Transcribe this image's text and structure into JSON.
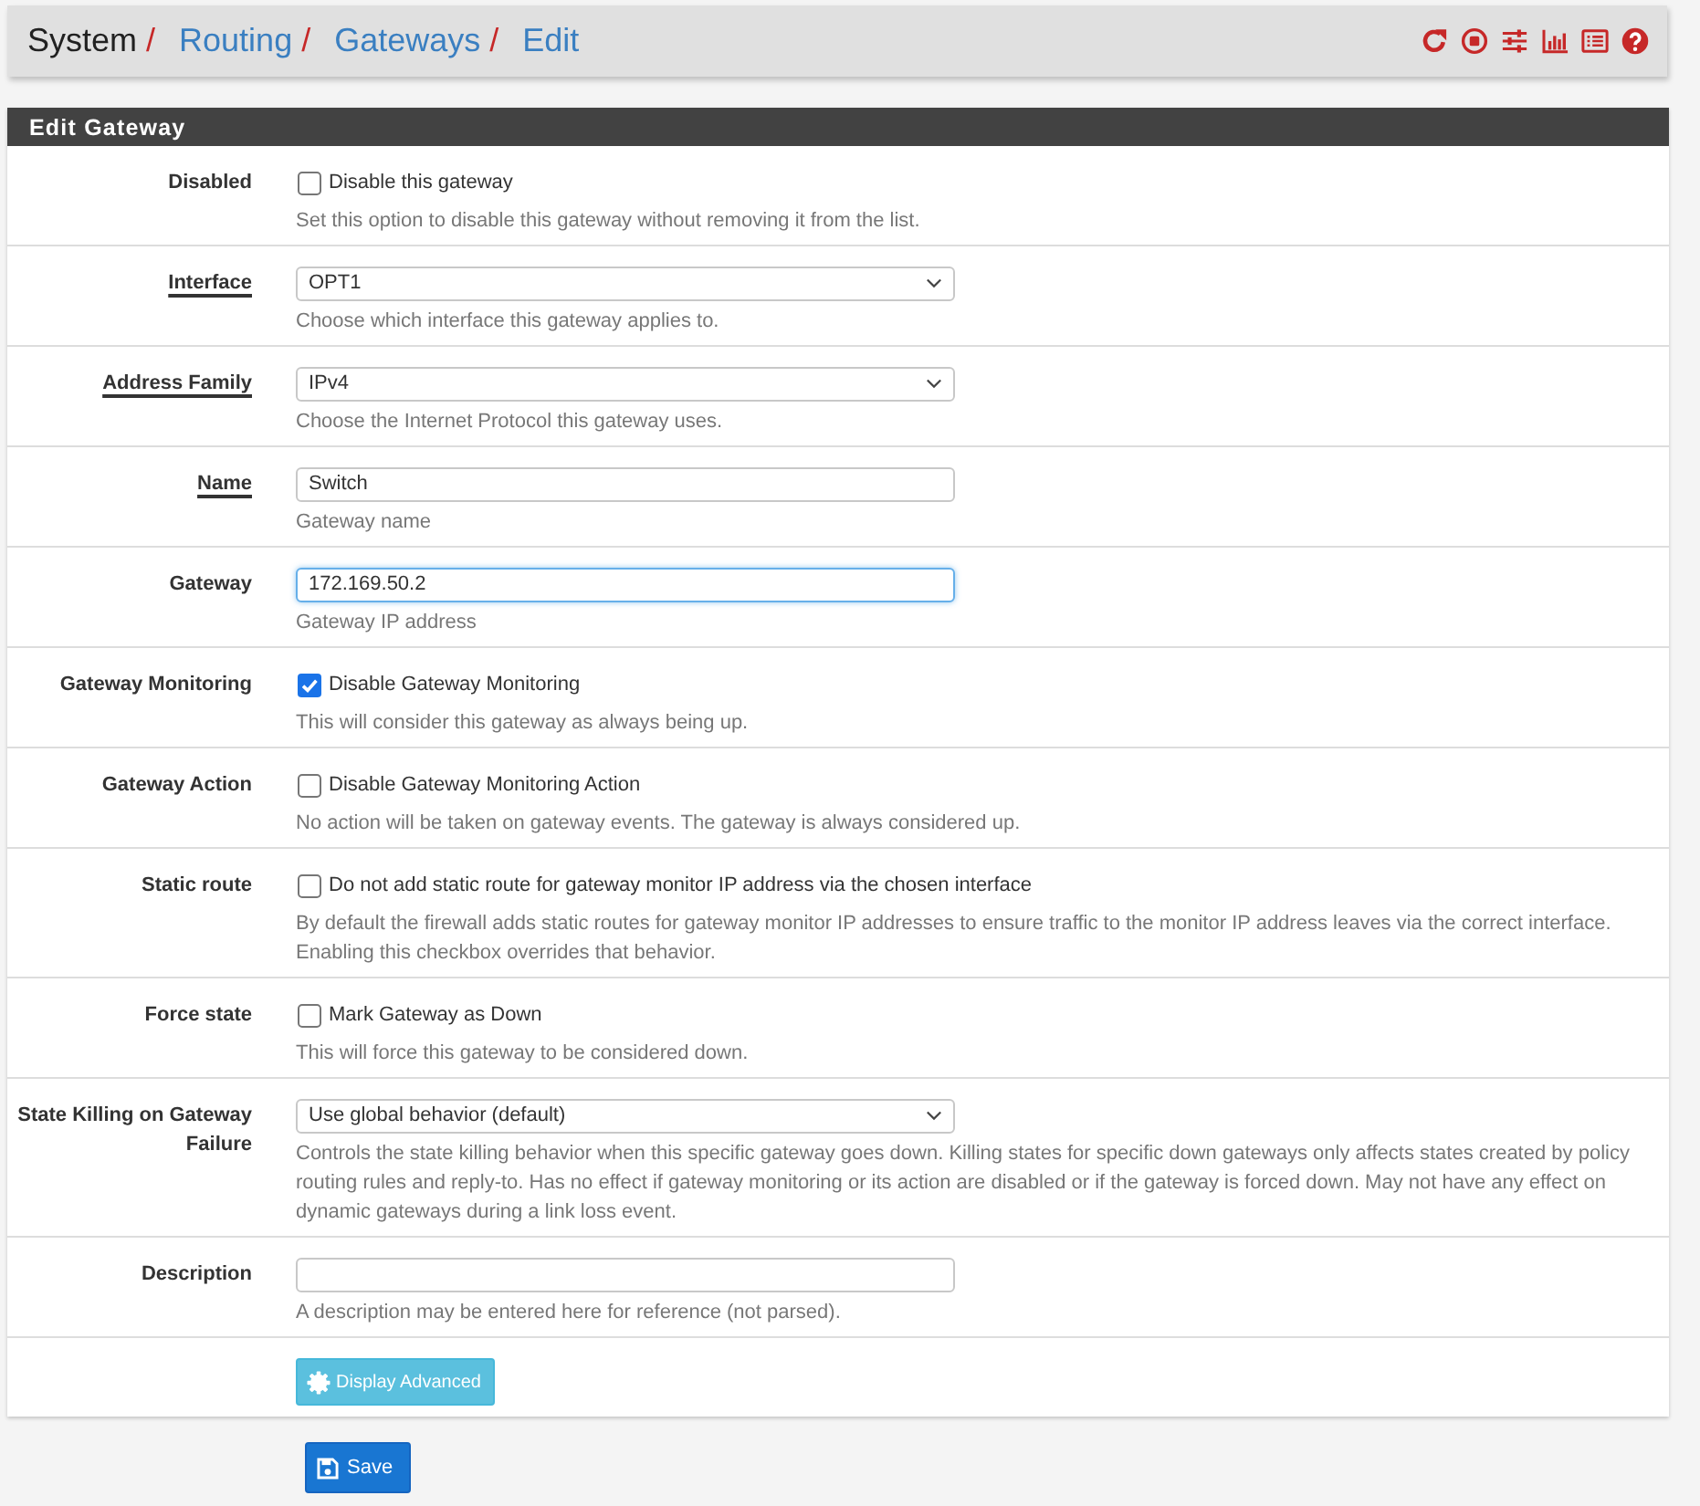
{
  "header": {
    "breadcrumb": [
      {
        "label": "System",
        "link": false,
        "separator": "/"
      },
      {
        "label": "Routing",
        "link": true,
        "separator": "/"
      },
      {
        "label": "Gateways",
        "link": true,
        "separator": "/"
      },
      {
        "label": "Edit",
        "link": true
      }
    ]
  },
  "panel": {
    "title": "Edit Gateway",
    "rows": [
      {
        "kind": "checkbox",
        "label": "Disabled",
        "required": false,
        "option": "Disable this gateway",
        "checked": false,
        "help": "Set this option to disable this gateway without removing it from the list."
      },
      {
        "kind": "select",
        "label": "Interface",
        "required": true,
        "value": "OPT1",
        "help": "Choose which interface this gateway applies to."
      },
      {
        "kind": "select",
        "label": "Address Family",
        "required": true,
        "value": "IPv4",
        "help": "Choose the Internet Protocol this gateway uses."
      },
      {
        "kind": "text",
        "label": "Name",
        "required": true,
        "value": "Switch",
        "focused": false,
        "help": "Gateway name"
      },
      {
        "kind": "text",
        "label": "Gateway",
        "required": false,
        "value": "172.169.50.2",
        "focused": true,
        "help": "Gateway IP address"
      },
      {
        "kind": "checkbox",
        "label": "Gateway Monitoring",
        "required": false,
        "option": "Disable Gateway Monitoring",
        "checked": true,
        "help": "This will consider this gateway as always being up."
      },
      {
        "kind": "checkbox",
        "label": "Gateway Action",
        "required": false,
        "option": "Disable Gateway Monitoring Action",
        "checked": false,
        "help": "No action will be taken on gateway events. The gateway is always considered up."
      },
      {
        "kind": "checkbox",
        "label": "Static route",
        "required": false,
        "option": "Do not add static route for gateway monitor IP address via the chosen interface",
        "checked": false,
        "help": "By default the firewall adds static routes for gateway monitor IP addresses to ensure traffic to the monitor IP address leaves via the correct interface. Enabling this checkbox overrides that behavior."
      },
      {
        "kind": "checkbox",
        "label": "Force state",
        "required": false,
        "option": "Mark Gateway as Down",
        "checked": false,
        "help": "This will force this gateway to be considered down."
      },
      {
        "kind": "select",
        "label": "State Killing on Gateway Failure",
        "required": false,
        "value": "Use global behavior (default)",
        "help": "Controls the state killing behavior when this specific gateway goes down. Killing states for specific down gateways only affects states created by policy routing rules and reply-to. Has no effect if gateway monitoring or its action are disabled or if the gateway is forced down. May not have any effect on dynamic gateways during a link loss event."
      },
      {
        "kind": "text",
        "label": "Description",
        "required": false,
        "focused": false,
        "help": "A description may be entered here for reference (not parsed)."
      },
      {
        "kind": "button",
        "button": "Display Advanced"
      }
    ]
  },
  "save_button": {
    "label": "Save"
  }
}
